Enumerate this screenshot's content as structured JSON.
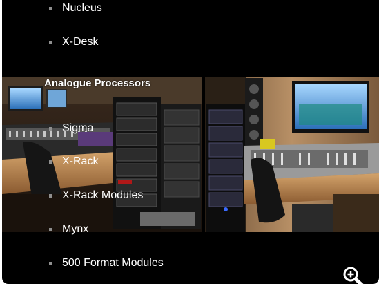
{
  "menu": {
    "items_top": [
      {
        "label": "Nucleus"
      },
      {
        "label": "X-Desk"
      }
    ],
    "heading": "Analogue Processors",
    "items_bottom": [
      {
        "label": "Sigma"
      },
      {
        "label": "X-Rack"
      },
      {
        "label": "X-Rack Modules"
      },
      {
        "label": "Mynx"
      },
      {
        "label": "500 Format Modules"
      }
    ]
  },
  "icons": {
    "zoom": "zoom-in-icon"
  },
  "colors": {
    "background": "#000000",
    "text": "#ffffff",
    "bullet": "#8f8f8f"
  }
}
